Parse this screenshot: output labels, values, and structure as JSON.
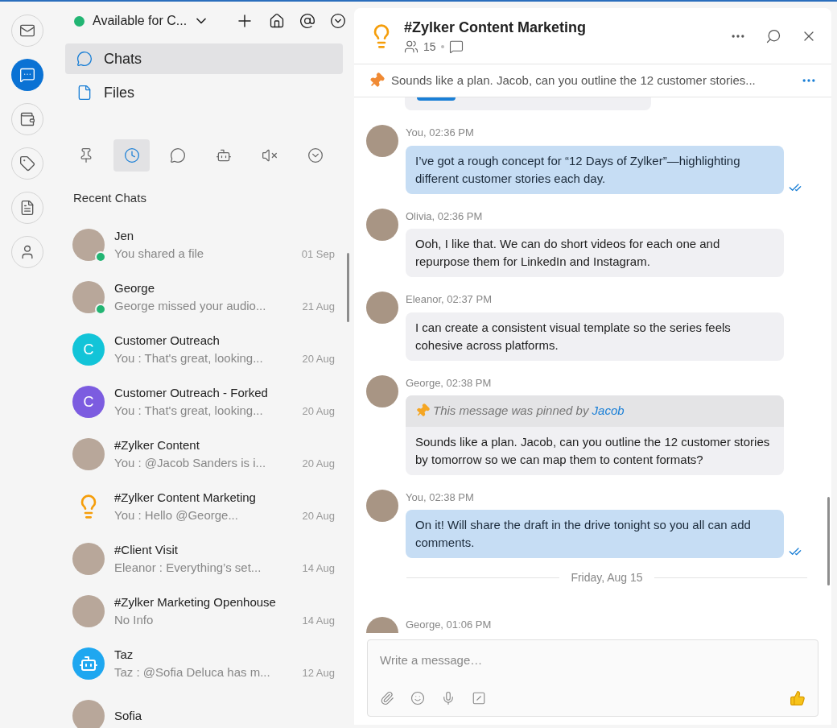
{
  "rail": [
    {
      "kind": "mail",
      "selected": false
    },
    {
      "kind": "chat",
      "selected": true
    },
    {
      "kind": "wallet",
      "selected": false
    },
    {
      "kind": "tasks",
      "selected": false
    },
    {
      "kind": "notes",
      "selected": false
    },
    {
      "kind": "contacts",
      "selected": false
    }
  ],
  "top_bar": {
    "status": "Available for C...",
    "online": true
  },
  "nav": [
    {
      "kind": "chats",
      "label": "Chats",
      "selected": true
    },
    {
      "kind": "files",
      "label": "Files",
      "selected": false
    }
  ],
  "filter_tabs": [
    {
      "kind": "pinned",
      "selected": false
    },
    {
      "kind": "recent",
      "selected": true
    },
    {
      "kind": "chats",
      "selected": false
    },
    {
      "kind": "bots",
      "selected": false
    },
    {
      "kind": "muted",
      "selected": false
    },
    {
      "kind": "more",
      "selected": false
    }
  ],
  "recent_chats": {
    "title": "Recent Chats",
    "items": [
      {
        "name": "Jen",
        "preview": "You shared a file",
        "date": "01 Sep",
        "kind": "photo",
        "online": true
      },
      {
        "name": "George",
        "preview": "George missed your audio...",
        "date": "21 Aug",
        "kind": "photo",
        "online": true
      },
      {
        "name": "Customer Outreach",
        "preview": "You : That's great, looking...",
        "date": "20 Aug",
        "kind": "letter",
        "letter": "C",
        "color": "#12c4d8",
        "online": false
      },
      {
        "name": "Customer Outreach - Forked",
        "preview": "You : That's great, looking...",
        "date": "20 Aug",
        "kind": "letter",
        "letter": "C",
        "color": "#7c5ce0",
        "online": false
      },
      {
        "name": "#Zylker Content",
        "preview": "You : @Jacob Sanders  is i...",
        "date": "20 Aug",
        "kind": "photo",
        "online": false
      },
      {
        "name": "#Zylker Content Marketing",
        "preview": "You : Hello @George...",
        "date": "20 Aug",
        "kind": "bulb",
        "online": false
      },
      {
        "name": "#Client Visit",
        "preview": "Eleanor : Everything’s set...",
        "date": "14 Aug",
        "kind": "photo",
        "online": false
      },
      {
        "name": "#Zylker Marketing Openhouse",
        "preview": "No Info",
        "date": "14 Aug",
        "kind": "photo",
        "online": false
      },
      {
        "name": "Taz",
        "preview": "Taz : @Sofia Deluca has m...",
        "date": "12 Aug",
        "kind": "bot",
        "online": false
      },
      {
        "name": "Sofia",
        "kind": "photo",
        "online": false
      }
    ]
  },
  "chat": {
    "title": "#Zylker Content Marketing",
    "member_count": "15",
    "pinned": "Sounds like a plan. Jacob, can you outline the 12 customer stories...",
    "messages": [
      {
        "kind": "message",
        "sender": "You, 02:36 PM",
        "own": true,
        "read": true,
        "text": "I’ve got a rough concept for “12 Days of Zylker”—highlighting different customer stories each day."
      },
      {
        "kind": "message",
        "sender": "Olivia, 02:36 PM",
        "own": false,
        "read": false,
        "text": "Ooh, I like that. We can do short videos for each one and repurpose them for LinkedIn and Instagram."
      },
      {
        "kind": "message",
        "sender": "Eleanor, 02:37 PM",
        "own": false,
        "read": false,
        "text": "I can create a consistent visual template so the series feels cohesive across platforms."
      },
      {
        "kind": "message",
        "sender": "George, 02:38 PM",
        "own": false,
        "read": false,
        "pin_notice": "This message was pinned by",
        "pinned_by": "Jacob",
        "text": "Sounds like a plan. Jacob, can you outline the 12 customer stories by tomorrow so we can map them to content formats?"
      },
      {
        "kind": "message",
        "sender": "You, 02:38 PM",
        "own": true,
        "read": true,
        "text": "On it! Will share the draft in the drive tonight so you all can add comments."
      },
      {
        "kind": "divider",
        "text": "Friday, Aug 15"
      },
      {
        "kind": "message",
        "sender": "George, 01:06 PM"
      }
    ],
    "composer": {
      "placeholder": "Write a message…"
    }
  }
}
